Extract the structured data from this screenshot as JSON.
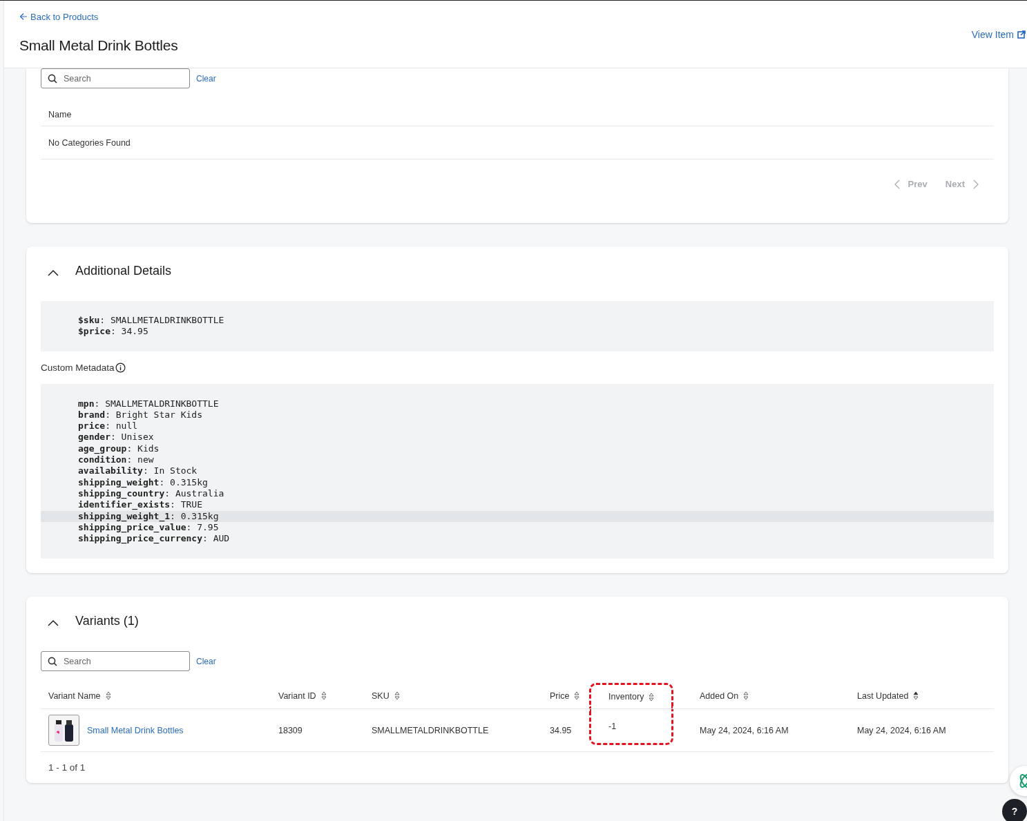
{
  "header": {
    "back_link": "Back to Products",
    "title": "Small Metal Drink Bottles",
    "view_link": "View Item"
  },
  "categories": {
    "search": {
      "placeholder": "Search"
    },
    "clear": "Clear",
    "columns": [
      "Name"
    ],
    "empty_message": "No Categories Found",
    "pagination": {
      "prev": {
        "label": "Prev",
        "disabled": true
      },
      "next": {
        "label": "Next",
        "disabled": true
      }
    }
  },
  "additional_details": {
    "title": "Additional Details",
    "expanded": true,
    "system_fields": [
      {
        "text": "**$sku**: SMALLMETALDRINKBOTTLE",
        "highlighted": false
      },
      {
        "text": "**$price**: 34.95",
        "highlighted": false
      }
    ],
    "custom_label": "Custom Metadata",
    "custom_fields": [
      {
        "text": "**mpn**: SMALLMETALDRINKBOTTLE",
        "highlighted": false
      },
      {
        "text": "**brand**: Bright Star Kids",
        "highlighted": false
      },
      {
        "text": "**price**: null",
        "highlighted": false
      },
      {
        "text": "**gender**: Unisex",
        "highlighted": false
      },
      {
        "text": "**age_group**: Kids",
        "highlighted": false
      },
      {
        "text": "**condition**: new",
        "highlighted": false
      },
      {
        "text": "**availability**: In Stock",
        "highlighted": false
      },
      {
        "text": "**shipping_weight**: 0.315kg",
        "highlighted": false
      },
      {
        "text": "**shipping_country**: Australia",
        "highlighted": false
      },
      {
        "text": "**identifier_exists**: TRUE",
        "highlighted": false
      },
      {
        "text": "**shipping_weight_1**: 0.315kg",
        "highlighted": true
      },
      {
        "text": "**shipping_price_value**: 7.95",
        "highlighted": false
      },
      {
        "text": "**shipping_price_currency**: AUD",
        "highlighted": false
      }
    ]
  },
  "variants": {
    "title": "Variants (1)",
    "expanded": true,
    "search": {
      "placeholder": "Search"
    },
    "clear": "Clear",
    "columns": [
      {
        "label": "Variant Name",
        "sorted": false,
        "annotated": false
      },
      {
        "label": "Variant ID",
        "sorted": false,
        "annotated": false
      },
      {
        "label": "SKU",
        "sorted": false,
        "annotated": false
      },
      {
        "label": "Price",
        "sorted": false,
        "annotated": false
      },
      {
        "label": "Inventory",
        "sorted": false,
        "annotated": true
      },
      {
        "label": "Added On",
        "sorted": false,
        "annotated": false
      },
      {
        "label": "Last Updated",
        "sorted": true,
        "annotated": false
      }
    ],
    "rows": [
      {
        "cells": [
          {
            "kind": "link",
            "text": "Small Metal Drink Bottles"
          },
          {
            "kind": "text",
            "text": "18309"
          },
          {
            "kind": "text",
            "text": "SMALLMETALDRINKBOTTLE"
          },
          {
            "kind": "text",
            "text": "34.95"
          },
          {
            "kind": "text",
            "text": "-1"
          },
          {
            "kind": "text",
            "text": "May 24, 2024, 6:16 AM"
          },
          {
            "kind": "text",
            "text": "May 24, 2024, 6:16 AM"
          }
        ]
      }
    ],
    "range": "1 - 1 of 1"
  },
  "help_button": "?"
}
